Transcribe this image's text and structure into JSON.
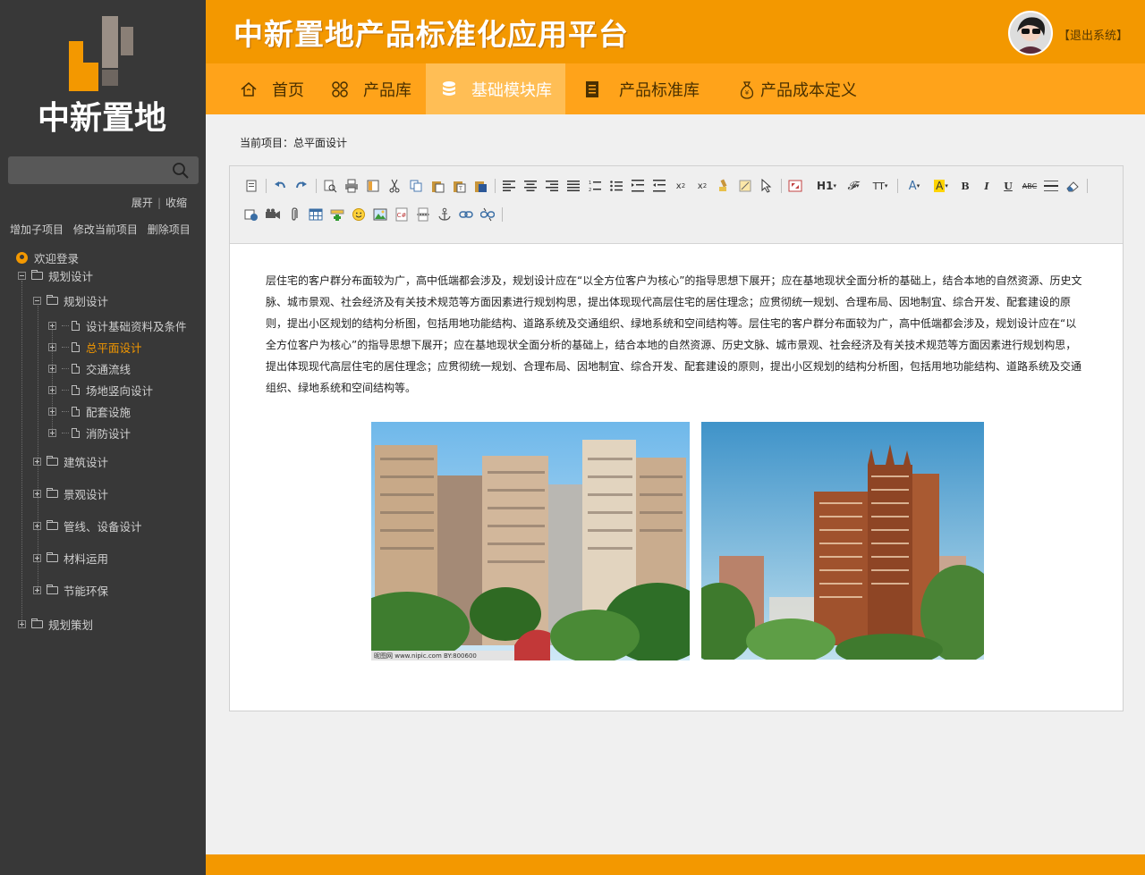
{
  "app": {
    "title": "中新置地产品标准化应用平台",
    "logo_text": "中新置地",
    "logout_label": "【退出系统】"
  },
  "colors": {
    "brand_orange": "#f39800",
    "nav_orange": "#ffa31a",
    "nav_active": "#ffbe55",
    "sidebar_bg": "#383838",
    "active_tree_item": "#f39800"
  },
  "nav": {
    "items": [
      {
        "label": "首页",
        "icon": "home-icon"
      },
      {
        "label": "产品库",
        "icon": "grid-icon"
      },
      {
        "label": "基础模块库",
        "icon": "database-icon",
        "active": true
      },
      {
        "label": "产品标准库",
        "icon": "document-icon"
      },
      {
        "label": "产品成本定义",
        "icon": "money-bag-icon"
      }
    ]
  },
  "sidebar": {
    "search_placeholder": "",
    "expand_label": "展开",
    "separator": "|",
    "collapse_label": "收缩",
    "actions": [
      "增加子项目",
      "修改当前项目",
      "删除项目"
    ],
    "tree": {
      "welcome": "欢迎登录",
      "root": "规划设计",
      "sub": "规划设计",
      "leaves": [
        "设计基础资料及条件",
        "总平面设计",
        "交通流线",
        "场地竖向设计",
        "配套设施",
        "消防设计"
      ],
      "folders": [
        "建筑设计",
        "景观设计",
        "管线、设备设计",
        "材料运用",
        "节能环保"
      ],
      "bottom": "规划策划",
      "active_leaf": "总平面设计"
    }
  },
  "main": {
    "breadcrumb": "当前项目：总平面设计",
    "paragraph": "层住宅的客户群分布面较为广，高中低端都会涉及，规划设计应在“以全方位客户为核心”的指导思想下展开；应在基地现状全面分析的基础上，结合本地的自然资源、历史文脉、城市景观、社会经济及有关技术规范等方面因素进行规划构思，提出体现现代高层住宅的居住理念；应贯彻统一规划、合理布局、因地制宜、综合开发、配套建设的原则，提出小区规划的结构分析图，包括用地功能结构、道路系统及交通组织、绿地系统和空间结构等。层住宅的客户群分布面较为广，高中低端都会涉及，规划设计应在“以全方位客户为核心”的指导思想下展开；应在基地现状全面分析的基础上，结合本地的自然资源、历史文脉、城市景观、社会经济及有关技术规范等方面因素进行规划构思，提出体现现代高层住宅的居住理念；应贯彻统一规划、合理布局、因地制宜、综合开发、配套建设的原则，提出小区规划的结构分析图，包括用地功能结构、道路系统及交通组织、绿地系统和空间结构等。",
    "photo1_caption": "昵图网 www.nipic.com   BY:800600"
  },
  "toolbar": {
    "heading_label": "H1",
    "font_label": "𝓕",
    "size_label": "TT",
    "font_color_label": "A",
    "bg_color_label": "A",
    "bold_label": "B",
    "italic_label": "I",
    "underline_label": "U",
    "strike_label": "ABC"
  }
}
